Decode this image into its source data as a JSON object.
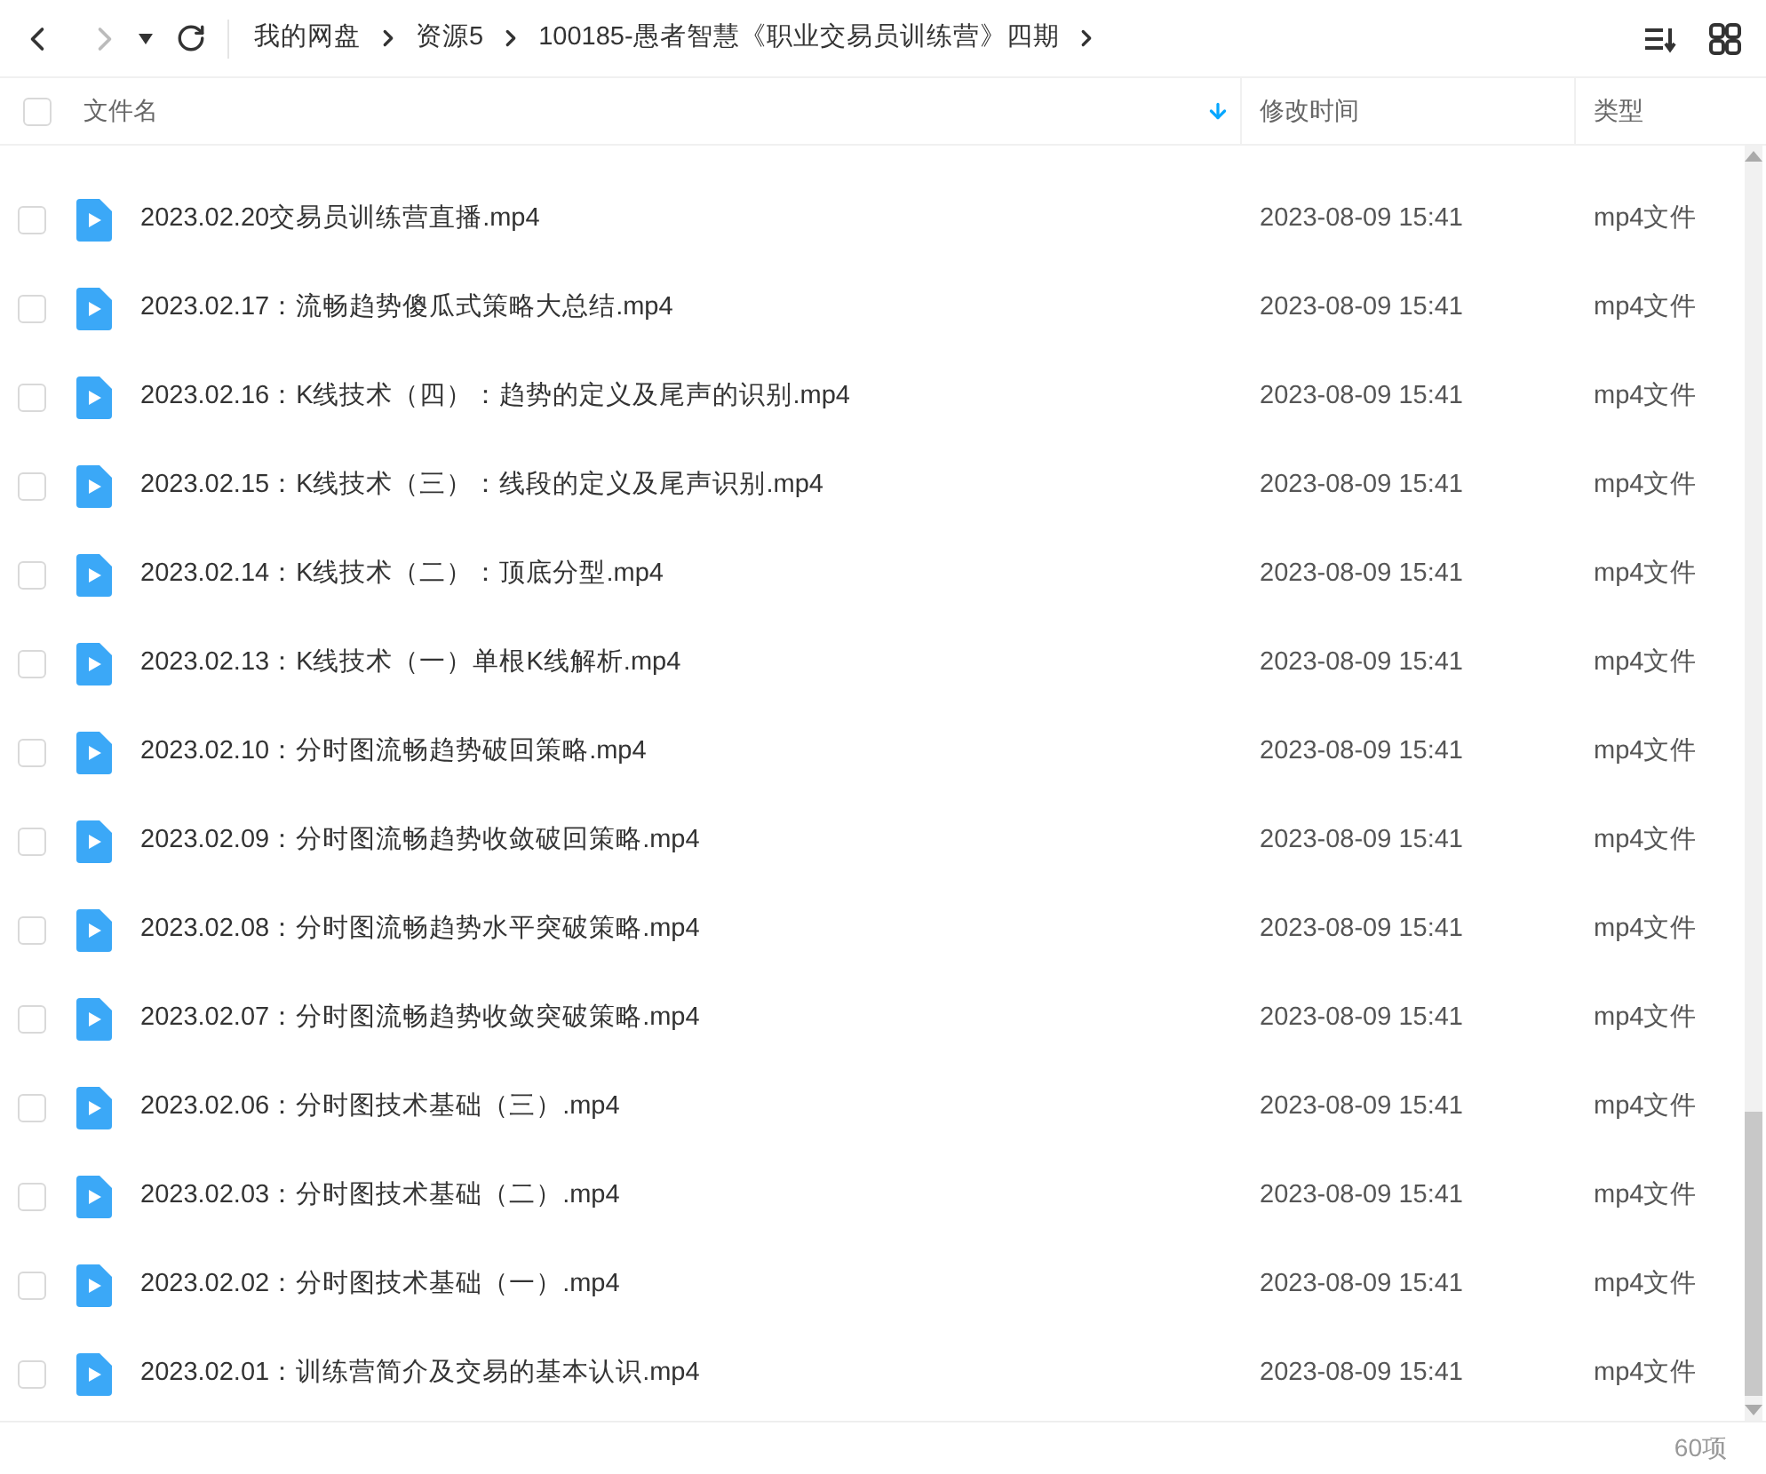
{
  "breadcrumb": [
    {
      "label": "我的网盘"
    },
    {
      "label": "资源5"
    },
    {
      "label": "100185-愚者智慧《职业交易员训练营》四期"
    }
  ],
  "table": {
    "columns": [
      {
        "label": "文件名",
        "sorted": true
      },
      {
        "label": "修改时间",
        "sorted": false
      },
      {
        "label": "类型",
        "sorted": false
      }
    ],
    "select_all": {
      "checked": false
    },
    "rows": [
      {
        "name": "2023.02.20交易员训练营直播.mp4",
        "modified": "2023-08-09 15:41",
        "type": "mp4文件",
        "checked": false
      },
      {
        "name": "2023.02.17：流畅趋势傻瓜式策略大总结.mp4",
        "modified": "2023-08-09 15:41",
        "type": "mp4文件",
        "checked": false
      },
      {
        "name": "2023.02.16：K线技术（四）：趋势的定义及尾声的识别.mp4",
        "modified": "2023-08-09 15:41",
        "type": "mp4文件",
        "checked": false
      },
      {
        "name": "2023.02.15：K线技术（三）：线段的定义及尾声识别.mp4",
        "modified": "2023-08-09 15:41",
        "type": "mp4文件",
        "checked": false
      },
      {
        "name": "2023.02.14：K线技术（二）：顶底分型.mp4",
        "modified": "2023-08-09 15:41",
        "type": "mp4文件",
        "checked": false
      },
      {
        "name": "2023.02.13：K线技术（一）单根K线解析.mp4",
        "modified": "2023-08-09 15:41",
        "type": "mp4文件",
        "checked": false
      },
      {
        "name": "2023.02.10：分时图流畅趋势破回策略.mp4",
        "modified": "2023-08-09 15:41",
        "type": "mp4文件",
        "checked": false
      },
      {
        "name": "2023.02.09：分时图流畅趋势收敛破回策略.mp4",
        "modified": "2023-08-09 15:41",
        "type": "mp4文件",
        "checked": false
      },
      {
        "name": "2023.02.08：分时图流畅趋势水平突破策略.mp4",
        "modified": "2023-08-09 15:41",
        "type": "mp4文件",
        "checked": false
      },
      {
        "name": "2023.02.07：分时图流畅趋势收敛突破策略.mp4",
        "modified": "2023-08-09 15:41",
        "type": "mp4文件",
        "checked": false
      },
      {
        "name": "2023.02.06：分时图技术基础（三）.mp4",
        "modified": "2023-08-09 15:41",
        "type": "mp4文件",
        "checked": false
      },
      {
        "name": "2023.02.03：分时图技术基础（二）.mp4",
        "modified": "2023-08-09 15:41",
        "type": "mp4文件",
        "checked": false
      },
      {
        "name": "2023.02.02：分时图技术基础（一）.mp4",
        "modified": "2023-08-09 15:41",
        "type": "mp4文件",
        "checked": false
      },
      {
        "name": "2023.02.01：训练营简介及交易的基本认识.mp4",
        "modified": "2023-08-09 15:41",
        "type": "mp4文件",
        "checked": false
      }
    ]
  },
  "status_bar": {
    "count": "60项"
  }
}
